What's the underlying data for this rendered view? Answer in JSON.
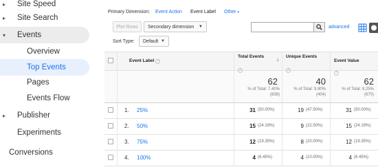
{
  "sidebar": {
    "items": [
      {
        "label": "Site Speed",
        "caret": "▸"
      },
      {
        "label": "Site Search",
        "caret": "▸"
      },
      {
        "label": "Events",
        "caret": "▾"
      },
      {
        "label": "Overview"
      },
      {
        "label": "Top Events"
      },
      {
        "label": "Pages"
      },
      {
        "label": "Events Flow"
      },
      {
        "label": "Publisher",
        "caret": "▸"
      },
      {
        "label": "Experiments"
      },
      {
        "label": "Conversions"
      }
    ],
    "active_item": "Top Events",
    "active_bg": "#e8f0fe",
    "section_bg": "#ececec"
  },
  "primary_dimension": {
    "label": "Primary Dimension:",
    "event_action": "Event Action",
    "event_label": "Event Label",
    "other": "Other"
  },
  "toolbar": {
    "plot_rows": "Plot Rows",
    "secondary_dimension": "Secondary dimension",
    "advanced": "advanced",
    "search_placeholder": ""
  },
  "sort": {
    "label": "Sort Type:",
    "value": "Default"
  },
  "table": {
    "columns": {
      "event_label": "Event Label",
      "total_events": "Total Events",
      "unique_events": "Unique Events",
      "event_value": "Event Value"
    },
    "totals": {
      "total_events": {
        "value": "62",
        "pct": "% of Total: 7.40%",
        "base": "(838)"
      },
      "unique_events": {
        "value": "40",
        "pct": "% of Total: 9.90%",
        "base": "(404)"
      },
      "event_value": {
        "value": "62",
        "pct": "% of Total: 9.25%",
        "base": "(670)"
      }
    },
    "rows": [
      {
        "index": "1.",
        "label": "25%",
        "total": "31",
        "total_pct": "(50.00%)",
        "unique": "19",
        "unique_pct": "(47.50%)",
        "value": "31",
        "value_pct": "(50.00%)"
      },
      {
        "index": "2.",
        "label": "50%",
        "total": "15",
        "total_pct": "(24.19%)",
        "unique": "9",
        "unique_pct": "(22.50%)",
        "value": "15",
        "value_pct": "(24.19%)"
      },
      {
        "index": "3.",
        "label": "75%",
        "total": "12",
        "total_pct": "(19.35%)",
        "unique": "8",
        "unique_pct": "(20.00%)",
        "value": "12",
        "value_pct": "(19.35%)"
      },
      {
        "index": "4.",
        "label": "100%",
        "total": "4",
        "total_pct": "(6.45%)",
        "unique": "4",
        "unique_pct": "(10.00%)",
        "value": "4",
        "value_pct": "(6.45%)"
      }
    ]
  },
  "colors": {
    "link": "#1a73e8",
    "active_nav_text": "#1a73e8"
  }
}
